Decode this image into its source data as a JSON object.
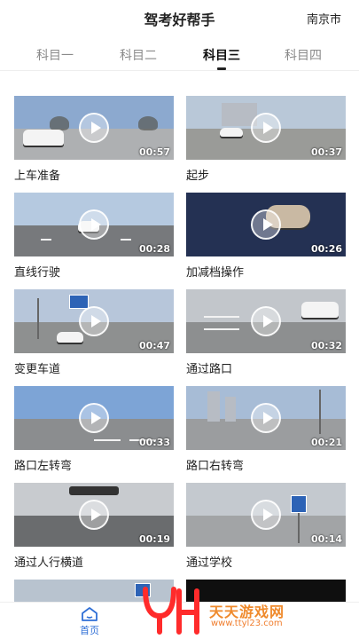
{
  "header": {
    "title": "驾考好帮手",
    "city": "南京市"
  },
  "tabs": [
    {
      "label": "科目一",
      "active": false
    },
    {
      "label": "科目二",
      "active": false
    },
    {
      "label": "科目三",
      "active": true
    },
    {
      "label": "科目四",
      "active": false
    }
  ],
  "videos": [
    {
      "title": "上车准备",
      "duration": "00:57"
    },
    {
      "title": "起步",
      "duration": "00:37"
    },
    {
      "title": "直线行驶",
      "duration": "00:28"
    },
    {
      "title": "加减档操作",
      "duration": "00:26"
    },
    {
      "title": "变更车道",
      "duration": "00:47"
    },
    {
      "title": "通过路口",
      "duration": "00:32"
    },
    {
      "title": "路口左转弯",
      "duration": "00:33"
    },
    {
      "title": "路口右转弯",
      "duration": "00:21"
    },
    {
      "title": "通过人行横道",
      "duration": "00:19"
    },
    {
      "title": "通过学校",
      "duration": "00:14"
    }
  ],
  "bottom_nav": {
    "home_label": "首页"
  },
  "watermark": {
    "brand": "天天游戏网",
    "url": "www.ttyl23.com"
  },
  "colors": {
    "accent": "#2f6fd6",
    "watermark": "#ef8a2c"
  }
}
